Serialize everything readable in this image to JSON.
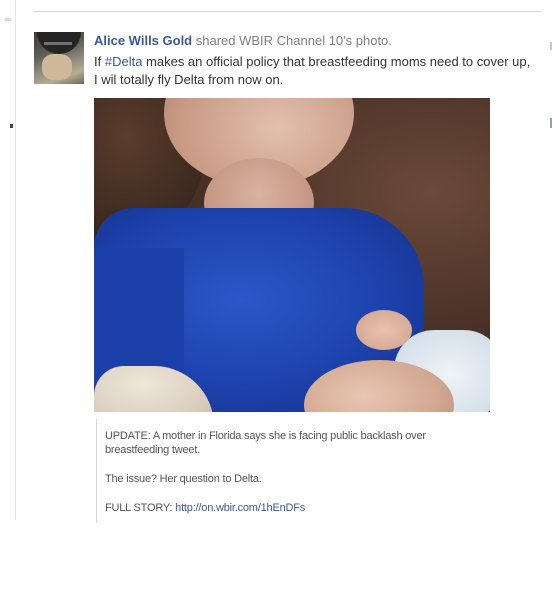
{
  "post": {
    "author": "Alice Wills Gold",
    "action": "shared WBIR Channel 10's photo.",
    "text_before_hashtag": "If ",
    "hashtag": "#Delta",
    "text_after_hashtag": " makes an official policy that breastfeeding moms need to cover up, I wil totally fly Delta from now on."
  },
  "caption": {
    "update": "UPDATE: A mother in Florida says she is facing public backlash over breastfeeding tweet.",
    "issue": "The issue? Her question to Delta.",
    "full_story_label": "FULL STORY: ",
    "full_story_link": "http://on.wbir.com/1hEnDFs"
  },
  "colors": {
    "link": "#3b5998",
    "secondary_text": "#7f7f7f",
    "body_text": "#333333"
  }
}
